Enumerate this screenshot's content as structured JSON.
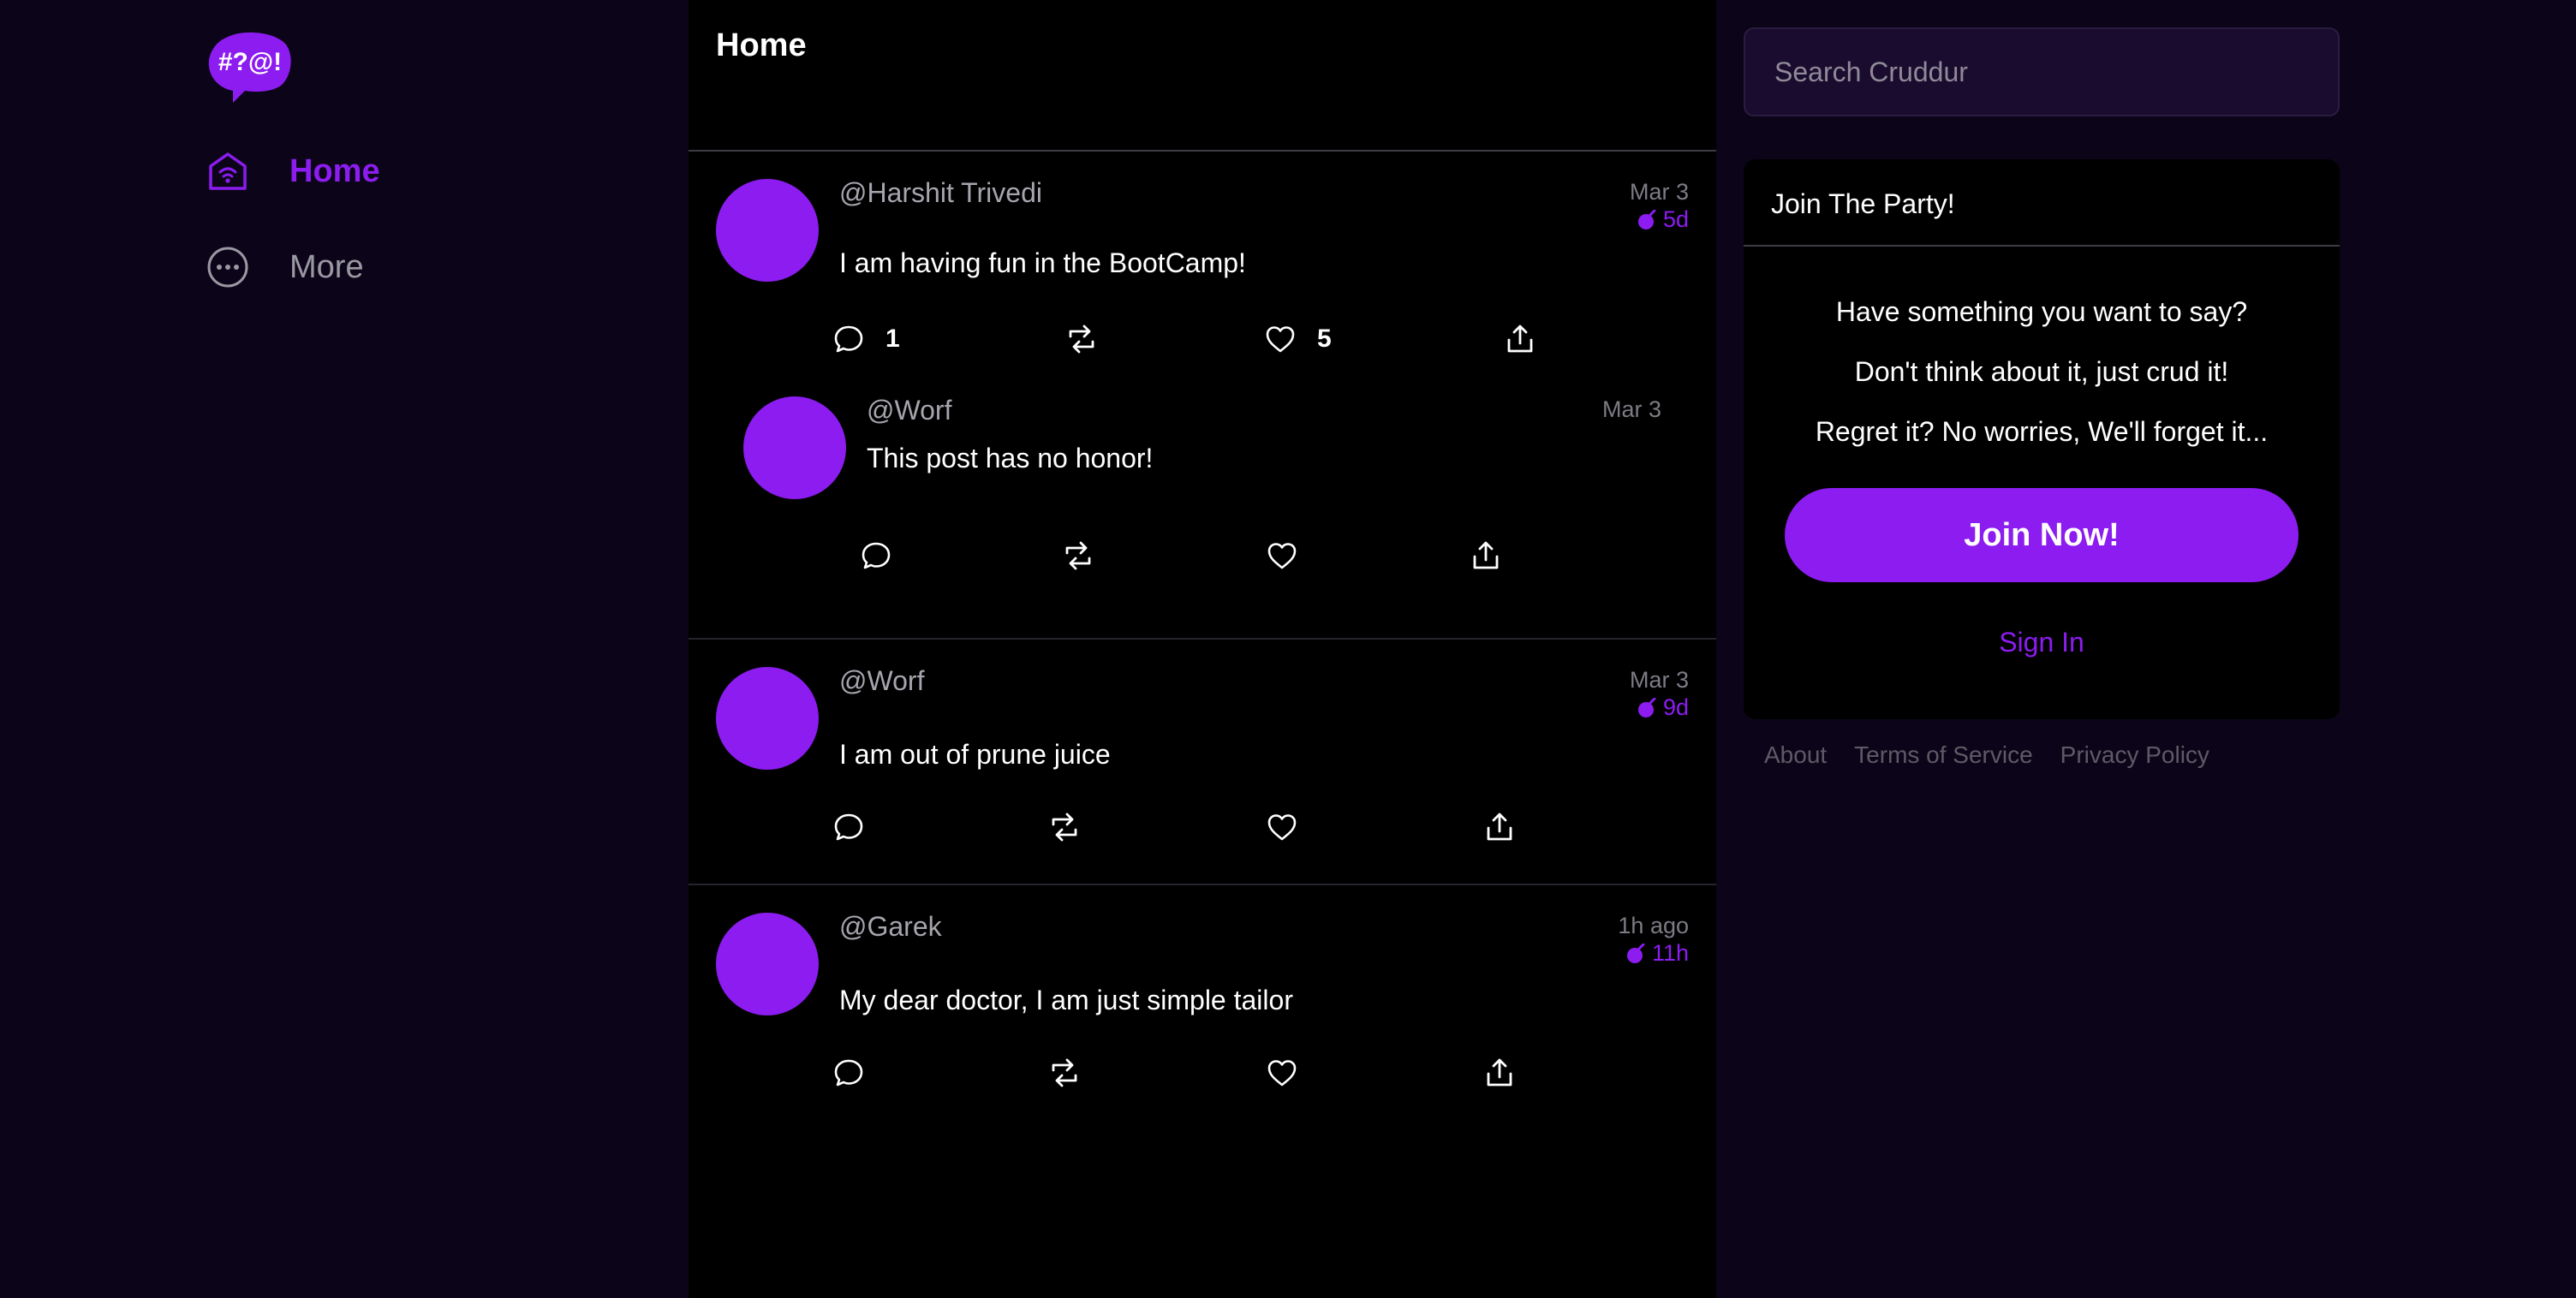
{
  "brand": {
    "logo_text": "#?@!",
    "accent": "#8c1cf0"
  },
  "nav": {
    "home_label": "Home",
    "more_label": "More"
  },
  "feed": {
    "title": "Home",
    "posts": [
      {
        "handle": "@Harshit Trivedi",
        "date": "Mar 3",
        "expiry": "5d",
        "text": "I am having fun in the BootCamp!",
        "reply_count": "1",
        "like_count": "5"
      },
      {
        "handle": "@Worf",
        "date": "Mar 3",
        "text": "This post has no honor!"
      },
      {
        "handle": "@Worf",
        "date": "Mar 3",
        "expiry": "9d",
        "text": "I am out of prune juice"
      },
      {
        "handle": "@Garek",
        "date": "1h ago",
        "expiry": "11h",
        "text": "My dear doctor, I am just simple tailor"
      }
    ]
  },
  "search": {
    "placeholder": "Search Cruddur"
  },
  "join_card": {
    "title": "Join The Party!",
    "line1": "Have something you want to say?",
    "line2": "Don't think about it, just crud it!",
    "line3": "Regret it? No worries, We'll forget it...",
    "button": "Join Now!",
    "signin": "Sign In"
  },
  "footer": {
    "about": "About",
    "terms": "Terms of Service",
    "privacy": "Privacy Policy"
  },
  "icons": [
    "logo-icon",
    "home-icon",
    "more-icon",
    "reply-icon",
    "repost-icon",
    "like-icon",
    "share-icon",
    "bomb-icon"
  ]
}
